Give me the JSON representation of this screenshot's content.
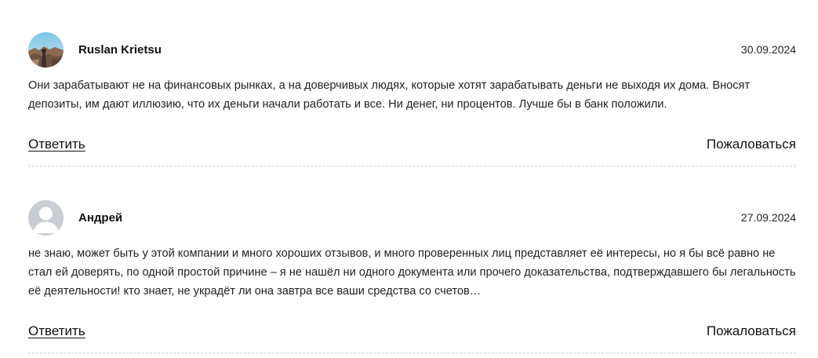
{
  "comments": [
    {
      "author": "Ruslan Krietsu",
      "date": "30.09.2024",
      "avatar_icon": "user-photo-avatar",
      "text": "Они зарабатывают не на финансовых рынках, а на доверчивых людях, которые хотят зарабатывать деньги не выходя их дома. Вносят депозиты, им дают иллюзию, что их деньги начали работать и все. Ни денег, ни процентов. Лучше бы в банк положили.",
      "reply_label": "Ответить",
      "report_label": "Пожаловаться"
    },
    {
      "author": "Андрей",
      "date": "27.09.2024",
      "avatar_icon": "default-user-avatar",
      "text": "не знаю, может быть у этой компании и много хороших отзывов, и много проверенных лиц представляет её интересы, но я бы всё равно не стал ей доверять, по одной простой причине – я не нашёл ни одного документа или прочего доказательства, подтверждавшего бы легальность её деятельности! кто знает, не украдёт ли она завтра все ваши средства со счетов…",
      "reply_label": "Ответить",
      "report_label": "Пожаловаться"
    }
  ],
  "colors": {
    "text": "#222222",
    "divider": "#d6d6d6",
    "default_avatar_bg": "#c8ccd3",
    "default_avatar_fg": "#ffffff"
  }
}
